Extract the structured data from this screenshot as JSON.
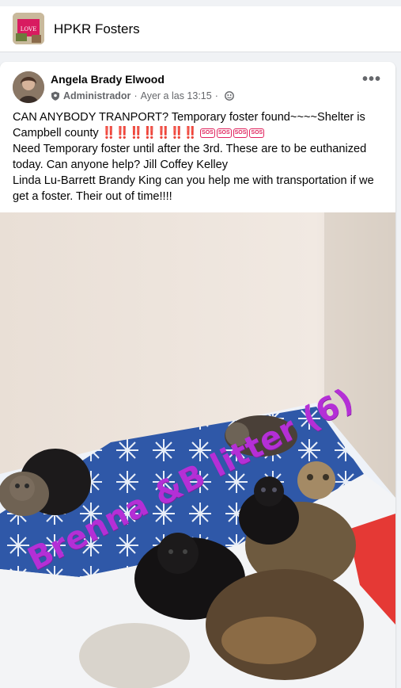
{
  "group": {
    "name": "HPKR Fosters",
    "thumb_text": "LOVE"
  },
  "post": {
    "author": "Angela Brady Elwood",
    "role": "Administrador",
    "time": "Ayer a las 13:15",
    "more_label": "•••",
    "lines": [
      "CAN ANYBODY TRANPORT? Temporary foster found~~~~Shelter is Campbell county",
      "Need Temporary foster until after the 3rd. These are to be euthanized today. Can anyone help? Jill Coffey Kelley",
      "Linda Lu-Barrett Brandy King can you help me with transportation if we get a foster. Their out of time!!!!"
    ],
    "bangs": "‼️‼️‼️‼️‼️‼️‼️",
    "sos": [
      "SOS",
      "SOS",
      "SOS",
      "SOS"
    ],
    "photo_caption": "Brenna &B litter (6)"
  },
  "colors": {
    "accent": "#1877f2",
    "overlay_text": "#b42fd6",
    "alert_red": "#e0245e"
  }
}
